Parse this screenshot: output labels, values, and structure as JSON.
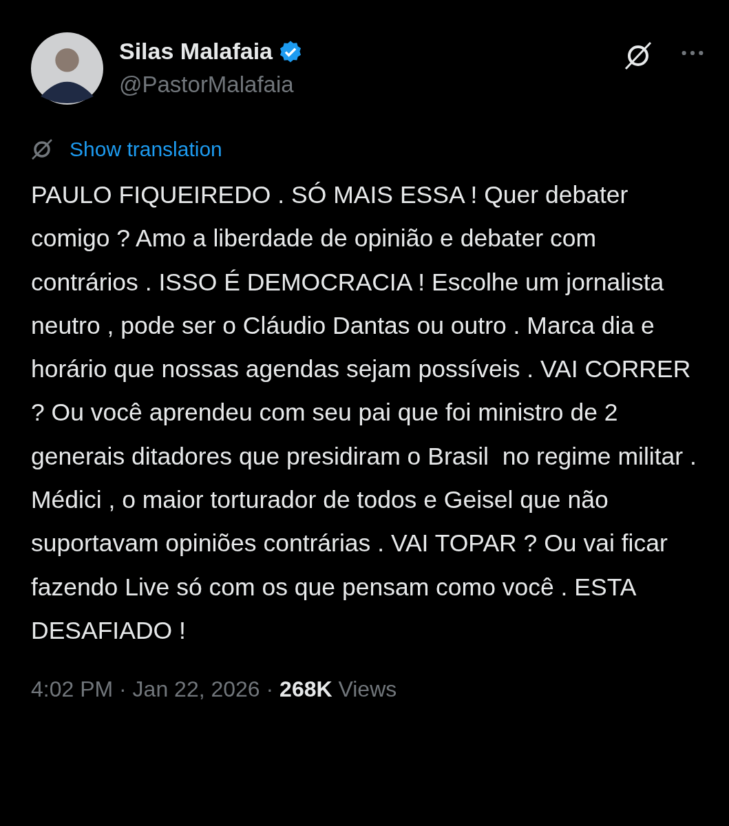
{
  "post": {
    "author": {
      "name": "Silas Malafaia",
      "verified": true,
      "handle": "@PastorMalafaia"
    },
    "translate_link": "Show translation",
    "text": "PAULO FIQUEIREDO . SÓ MAIS ESSA ! Quer debater comigo ? Amo a liberdade de opinião e debater com contrários . ISSO É DEMOCRACIA ! Escolhe um jornalista neutro , pode ser o Cláudio Dantas ou outro . Marca dia e horário que nossas agendas sejam possíveis . VAI CORRER ? Ou você aprendeu com seu pai que foi ministro de 2 generais ditadores que presidiram o Brasil  no regime militar . Médici , o maior torturador de todos e Geisel que não suportavam opiniões contrárias . VAI TOPAR ? Ou vai ficar fazendo Live só com os que pensam como você . ESTA DESAFIADO !",
    "meta": "4:02 PM · Jan 22, 2026 · **268K** Views"
  }
}
